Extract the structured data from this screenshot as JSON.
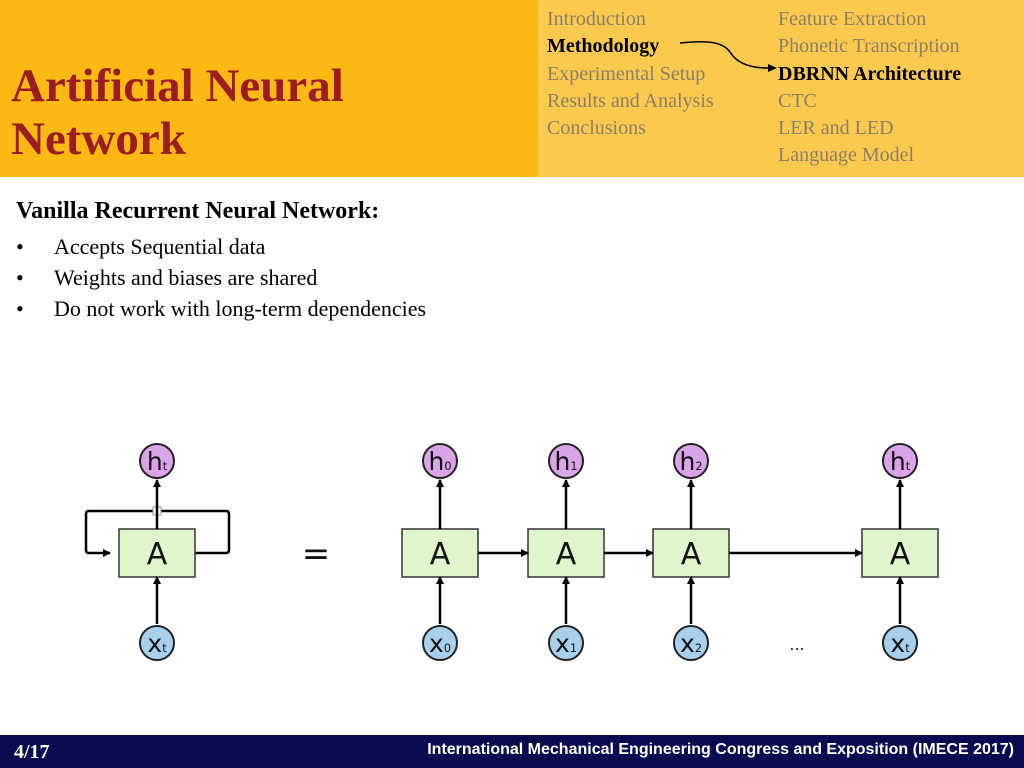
{
  "header": {
    "title": "Artificial Neural Network",
    "title_line1": "Artificial Neural",
    "title_line2": "Network",
    "colors": {
      "left_panel": "#fdb913",
      "right_panel": "#fcc94f",
      "title": "#9b1c22",
      "nav_inactive": "#8a7f66",
      "nav_active": "#000000"
    }
  },
  "nav": {
    "main_sections": [
      {
        "label": "Introduction",
        "active": false
      },
      {
        "label": "Methodology",
        "active": true
      },
      {
        "label": "Experimental Setup",
        "active": false
      },
      {
        "label": "Results and Analysis",
        "active": false
      },
      {
        "label": "Conclusions",
        "active": false
      }
    ],
    "subsections": [
      {
        "label": "Feature Extraction",
        "active": false
      },
      {
        "label": "Phonetic Transcription",
        "active": false
      },
      {
        "label": "DBRNN Architecture",
        "active": true
      },
      {
        "label": "CTC",
        "active": false
      },
      {
        "label": "LER and LED",
        "active": false
      },
      {
        "label": "Language Model",
        "active": false
      }
    ]
  },
  "content": {
    "heading": "Vanilla Recurrent Neural Network:",
    "bullet_symbol": "•",
    "bullets": [
      "Accepts Sequential data",
      "Weights and biases are shared",
      "Do not work with long-term dependencies"
    ]
  },
  "diagram": {
    "colors": {
      "cell_fill": "#dff5cc",
      "output_fill": "#dba3e8",
      "input_fill": "#a8d0ec",
      "stroke": "#000000"
    },
    "rolled": {
      "cell": "A",
      "output": {
        "main": "h",
        "sub": "t"
      },
      "input": {
        "main": "x",
        "sub": "t"
      }
    },
    "equals": "=",
    "unrolled": [
      {
        "cell": "A",
        "output": {
          "main": "h",
          "sub": "0"
        },
        "input": {
          "main": "x",
          "sub": "0"
        }
      },
      {
        "cell": "A",
        "output": {
          "main": "h",
          "sub": "1"
        },
        "input": {
          "main": "x",
          "sub": "1"
        }
      },
      {
        "cell": "A",
        "output": {
          "main": "h",
          "sub": "2"
        },
        "input": {
          "main": "x",
          "sub": "2"
        }
      },
      {
        "cell": "A",
        "output": {
          "main": "h",
          "sub": "t"
        },
        "input": {
          "main": "x",
          "sub": "t"
        }
      }
    ],
    "ellipsis": "..."
  },
  "footer": {
    "page": "4/17",
    "conference": "International Mechanical Engineering Congress and Exposition (IMECE 2017)",
    "background": "#0a0a50"
  }
}
